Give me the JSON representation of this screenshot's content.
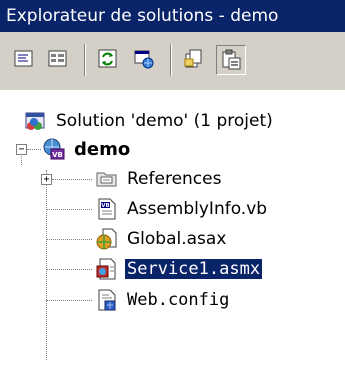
{
  "window": {
    "title": "Explorateur de solutions - demo"
  },
  "toolbar": {
    "buttons": [
      {
        "name": "view-code-icon"
      },
      {
        "name": "view-designer-icon"
      },
      {
        "name": "refresh-icon"
      },
      {
        "name": "copy-web-icon"
      },
      {
        "name": "show-all-files-icon"
      },
      {
        "name": "properties-icon"
      }
    ]
  },
  "tree": {
    "solution": "Solution 'demo' (1 projet)",
    "project": "demo",
    "expander_project": "−",
    "expander_references": "+",
    "items": [
      {
        "label": "References"
      },
      {
        "label": "AssemblyInfo.vb"
      },
      {
        "label": "Global.asax"
      },
      {
        "label": "Service1.asmx"
      },
      {
        "label": "Web.config"
      }
    ]
  },
  "colors": {
    "title_bg": "#0a246a",
    "toolbar_bg": "#d4d0c8",
    "selection_bg": "#0a246a"
  }
}
